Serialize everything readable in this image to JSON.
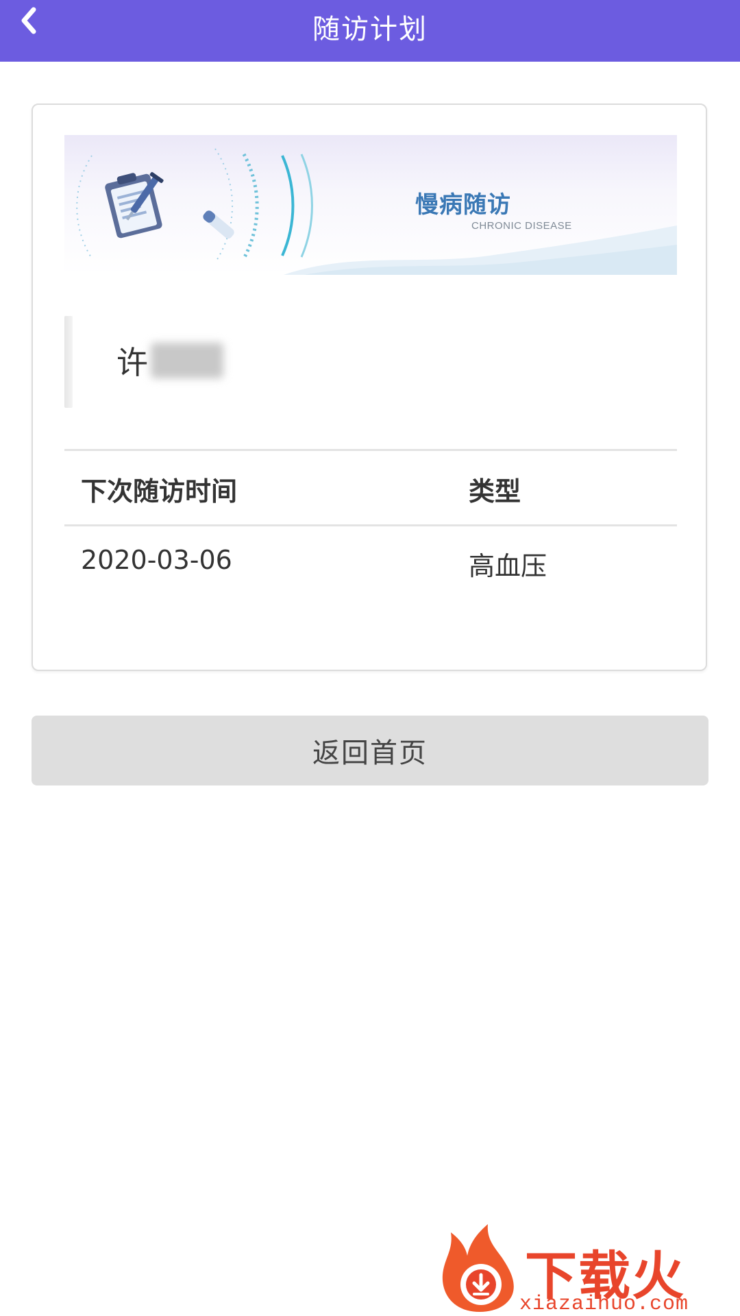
{
  "header": {
    "title": "随访计划",
    "back_icon": "chevron-left-icon"
  },
  "banner": {
    "title": "慢病随访",
    "subtitle": "CHRONIC DISEASE"
  },
  "patient": {
    "name_visible": "许"
  },
  "table": {
    "columns": [
      "下次随访时间",
      "类型"
    ],
    "rows": [
      [
        "2020-03-06",
        "高血压"
      ]
    ]
  },
  "actions": {
    "home_label": "返回首页"
  },
  "watermark": {
    "text": "下载火",
    "domain": "xiazaihuo.com"
  },
  "colors": {
    "header_bg": "#6c5ce0",
    "button_bg": "#dedede",
    "banner_title": "#3a78b5",
    "watermark": "#e8452b"
  }
}
